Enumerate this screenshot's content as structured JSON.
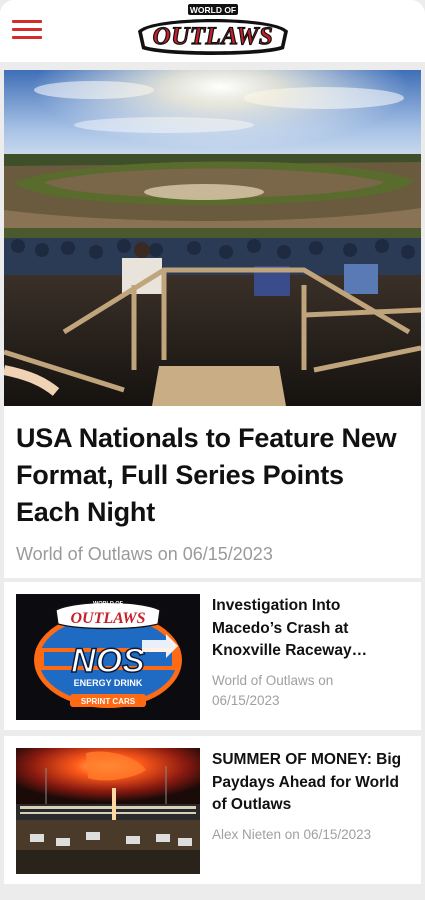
{
  "header": {
    "menu_icon": "hamburger-menu-icon",
    "logo": {
      "small_text": "WORLD OF",
      "main_text": "OUTLAWS"
    },
    "accent_color": "#d42b2b"
  },
  "featured": {
    "title": "USA Nationals to Feature New Format, Full Series Points Each Night",
    "meta": "World of Outlaws on 06/15/2023"
  },
  "articles": [
    {
      "title": "Investigation Into Macedo’s Crash at Knoxville Raceway…",
      "meta_author": "World of Outlaws on",
      "meta_date": "06/15/2023",
      "thumb_logo": {
        "top": "WORLD OF",
        "brand": "OUTLAWS",
        "nos": "NOS",
        "sub": "ENERGY DRINK",
        "banner": "SPRINT CARS"
      }
    },
    {
      "title": "SUMMER OF MONEY: Big Paydays Ahead for World of Outlaws",
      "meta": "Alex Nieten on 06/15/2023"
    }
  ]
}
